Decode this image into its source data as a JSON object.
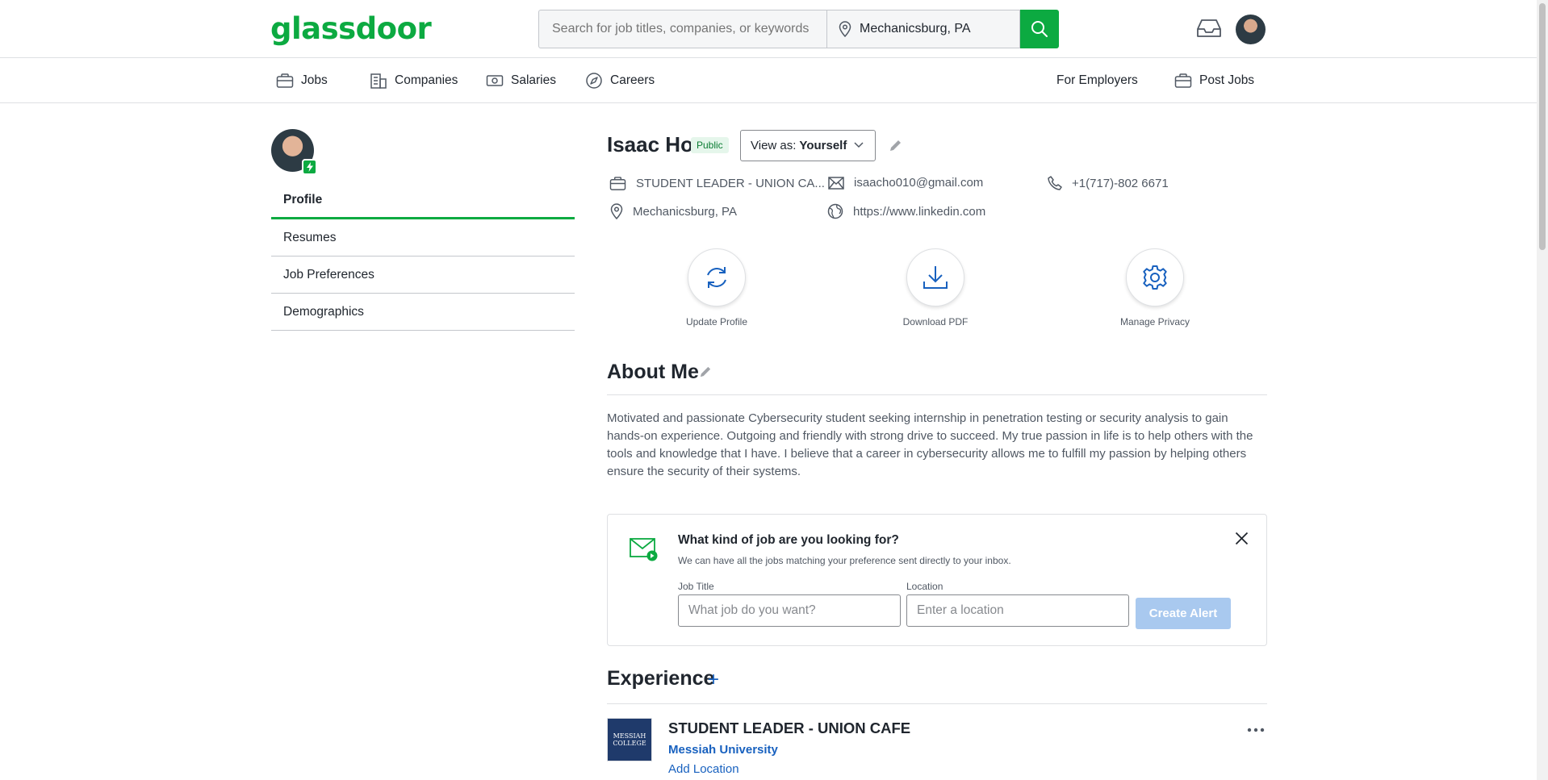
{
  "header": {
    "logo_text": "glassdoor",
    "search_placeholder": "Search for job titles, companies, or keywords",
    "location_value": "Mechanicsburg, PA"
  },
  "nav": {
    "items": [
      {
        "label": "Jobs",
        "icon": "briefcase-icon"
      },
      {
        "label": "Companies",
        "icon": "building-icon"
      },
      {
        "label": "Salaries",
        "icon": "money-icon"
      },
      {
        "label": "Careers",
        "icon": "compass-icon"
      }
    ],
    "for_employers": "For Employers",
    "post_jobs": "Post Jobs"
  },
  "sidebar": {
    "items": [
      {
        "label": "Profile",
        "active": true
      },
      {
        "label": "Resumes"
      },
      {
        "label": "Job Preferences"
      },
      {
        "label": "Demographics"
      }
    ]
  },
  "profile": {
    "name": "Isaac Ho",
    "visibility": "Public",
    "view_as_prefix": "View as:",
    "view_as_value": "Yourself",
    "job_title": "STUDENT LEADER - UNION CA...",
    "email": "isaacho010@gmail.com",
    "phone": "+1(717)-802 6671",
    "location": "Mechanicsburg, PA",
    "website": "https://www.linkedin.com"
  },
  "actions": [
    {
      "label": "Update Profile",
      "icon": "refresh-icon"
    },
    {
      "label": "Download PDF",
      "icon": "download-icon"
    },
    {
      "label": "Manage Privacy",
      "icon": "gear-icon"
    }
  ],
  "about": {
    "title": "About Me",
    "text": "Motivated and passionate Cybersecurity student seeking internship in penetration testing or security analysis to gain hands-on experience. Outgoing and friendly with strong drive to succeed. My true passion in life is to help others with the tools and knowledge that I have. I believe that a career in cybersecurity allows me to fulfill my passion by helping others ensure the security of their systems."
  },
  "job_alert": {
    "title": "What kind of job are you looking for?",
    "subtitle": "We can have all the jobs matching your preference sent directly to your inbox.",
    "job_title_label": "Job Title",
    "job_title_placeholder": "What job do you want?",
    "location_label": "Location",
    "location_placeholder": "Enter a location",
    "button": "Create Alert"
  },
  "experience": {
    "title": "Experience",
    "add_symbol": "+",
    "items": [
      {
        "title": "STUDENT LEADER - UNION CAFE",
        "company": "Messiah University",
        "location_link": "Add Location",
        "logo_text": "MESSIAH COLLEGE"
      }
    ]
  },
  "colors": {
    "brand_green": "#0caa41",
    "link_blue": "#1861bf",
    "disabled_button": "#a9c9ef"
  }
}
